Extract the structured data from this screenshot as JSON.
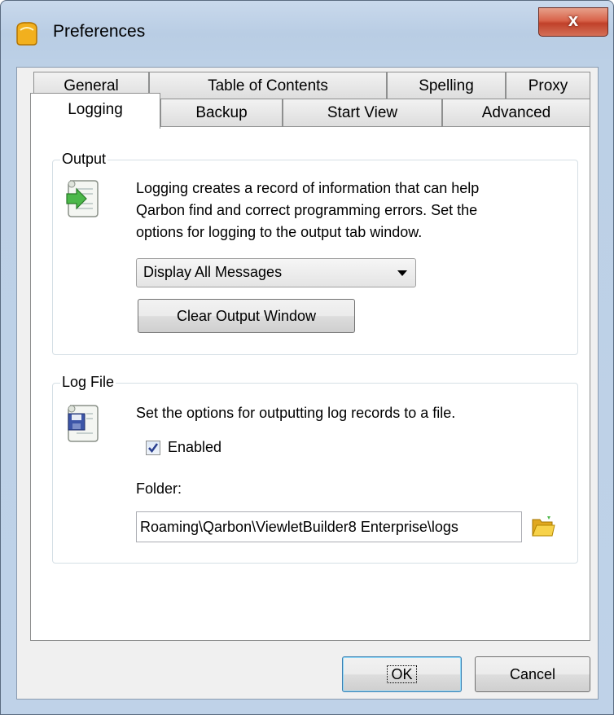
{
  "window": {
    "title": "Preferences",
    "close_symbol": "x"
  },
  "tabs": {
    "row_back": [
      "General",
      "Table of Contents",
      "Spelling",
      "Proxy"
    ],
    "row_front": [
      "Logging",
      "Backup",
      "Start View",
      "Advanced"
    ],
    "active": "Logging"
  },
  "output_group": {
    "label": "Output",
    "icon": "log-output-icon",
    "description_lines": [
      "Logging creates a record of information that can help",
      "Qarbon find and correct programming errors. Set the",
      "options for logging to the output tab window."
    ],
    "dropdown_value": "Display All Messages",
    "clear_button": "Clear Output Window"
  },
  "logfile_group": {
    "label": "Log File",
    "icon": "log-file-save-icon",
    "description": "Set the options for outputting log records to a file.",
    "enabled_label": "Enabled",
    "enabled_checked": true,
    "folder_label": "Folder:",
    "folder_value": "Roaming\\Qarbon\\ViewletBuilder8 Enterprise\\logs",
    "browse_icon": "folder-open-icon"
  },
  "footer": {
    "ok": "OK",
    "cancel": "Cancel"
  },
  "colors": {
    "title_bar": "#c9d9ec",
    "close_button": "#c0412a",
    "panel": "#ffffff",
    "client": "#f0f0f0"
  }
}
